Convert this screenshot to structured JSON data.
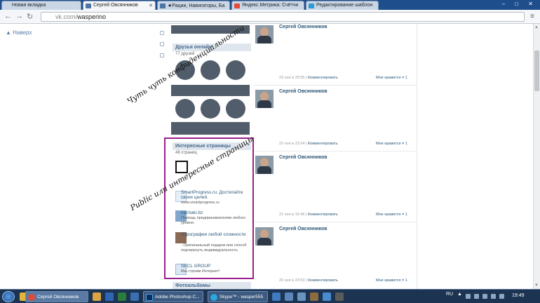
{
  "browser": {
    "tabs": [
      {
        "label": "Новая вкладка",
        "active": false
      },
      {
        "label": "Сергей Овсянников",
        "active": true
      },
      {
        "label": "★Рации, Навигаторы, Ба",
        "active": false
      },
      {
        "label": "Яндекс.Метрика: Счётчи",
        "active": false
      },
      {
        "label": "Редактирование шаблон",
        "active": false
      }
    ],
    "url_scheme": "vk.com/",
    "url_path": "wasperino",
    "window_controls": "– □ ✕"
  },
  "page": {
    "back_to_top": "▲ Наверх",
    "friends_block": {
      "title": "Друзья онлайн",
      "count": "77 друзей"
    },
    "pages_block": {
      "title": "Интересные страницы",
      "count": "48 страниц",
      "items": [
        {
          "title": "SmartProgress.ru. Достигайте своих целей.",
          "desc": "www.smartprogress.ru"
        },
        {
          "title": "nachalo.bz",
          "desc": "Помощь предпринимателям любого уровня."
        },
        {
          "title": "Аэрография любой сложности",
          "desc": "- Оригинальный подарок или способ подчеркнуть индивидуальность."
        },
        {
          "title": "SECL GROUP",
          "desc": "Мы строим Интернет!"
        }
      ]
    },
    "photos_block": {
      "title": "Фотоальбомы"
    },
    "posts": [
      {
        "author": "Сергей Овсянников",
        "time": "23 ноя в 20:55",
        "comment": "Комментировать",
        "like": "Мне нравится",
        "like_count": "1"
      },
      {
        "author": "Сергей Овсянников",
        "time": "22 ноя в 23:34",
        "comment": "Комментировать",
        "like": "Мне нравится",
        "like_count": "1"
      },
      {
        "author": "Сергей Овсянников",
        "time": "21 ноя в 15:46",
        "comment": "Комментировать",
        "like": "Мне нравится",
        "like_count": "1"
      },
      {
        "author": "Сергей Овсянников",
        "time": "20 ноя в 23:53",
        "comment": "Комментировать",
        "like": "Мне нравится",
        "like_count": "1"
      }
    ],
    "annotations": {
      "note1": "Чуть чуть конфиденциальности",
      "note2": "Public или интересные страницы"
    },
    "highlight_color": "#9b1f8c"
  },
  "taskbar": {
    "tasks": [
      {
        "label": "Сергей Овсянников",
        "icon": "chrome-icon",
        "active": true
      },
      {
        "label": "Adobe Photoshop C...",
        "icon": "photoshop-icon",
        "active": false
      },
      {
        "label": "Skype™ - wasper555",
        "icon": "skype-icon",
        "active": false
      }
    ],
    "lang": "RU",
    "time": "19:49"
  }
}
